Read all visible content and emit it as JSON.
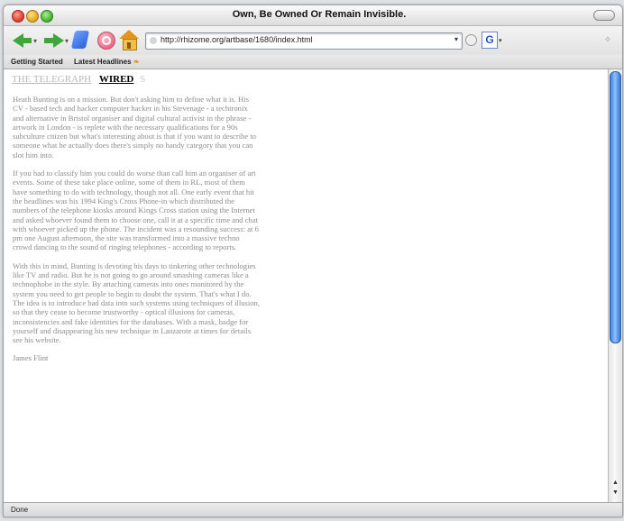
{
  "window": {
    "title": "Own, Be Owned Or Remain Invisible."
  },
  "toolbar": {
    "url": "http://rhizome.org/artbase/1680/index.html",
    "icons": [
      "back-icon",
      "forward-icon",
      "reload-icon",
      "stop-icon",
      "home-icon",
      "go-icon",
      "google-search-icon"
    ]
  },
  "bookmarks": {
    "items": [
      "Getting Started",
      "Latest Headlines"
    ]
  },
  "content": {
    "tabs": {
      "telegraph": "THE TELEGRAPH",
      "wired": "WIRED",
      "more": "S"
    },
    "paragraphs": [
      "Heath Bunting is on a mission. But don't asking him to define what it is. His CV - based tech and hacker computer hacker in his Stevenage - a techtronix and alternative in Bristol organiser and digital cultural activist in the phrase - artwork in London - is replete with the necessary qualifications for a 90s subculture citizen but what's interesting about is that if you want to describe to someone what he actually does there's simply no handy category that you can slot him into.",
      "If you had to classify him you could do worse than call him an organiser of art events. Some of these take place online, some of them in RL, most of them have something to do with technology, though not all. One early event that hit the headlines was his 1994 King's Cross Phone-in which distributed the numbers of the telephone kiosks around Kings Cross station using the Internet and asked whoever found them to choose one, call it at a specific time and chat with whoever picked up the phone. The incident was a resounding success: at 6 pm one August afternoon, the site was transformed into a massive techno crowd dancing to the sound of ringing telephones - according to reports.",
      "With this in mind, Bunting is devoting his days to tinkering other technologies like TV and radio. But he is not going to go around smashing cameras like a technophobe in the style. By attaching cameras into ones monitored by the system you need to get people to begin to doubt the system. That's what I do. The idea is to introduce bad data into such systems using techniques of illusion, so that they cease to become trustworthy - optical illusions for cameras, inconsistencies and fake identities for the databases. With a mask, badge for yourself and disappearing his new technique in Lanzarote at times for details see his website."
    ],
    "signature": "James Flint"
  },
  "status": {
    "text": "Done"
  }
}
